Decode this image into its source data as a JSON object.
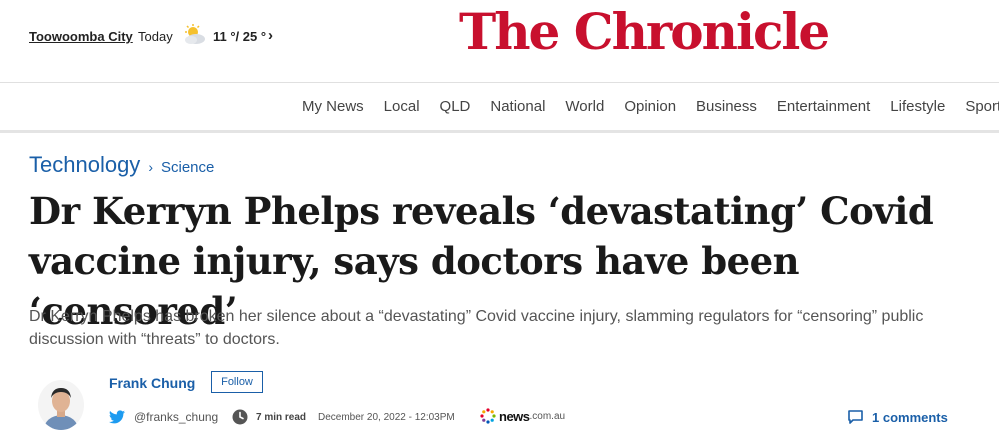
{
  "header": {
    "location": "Toowoomba City",
    "today_label": "Today",
    "weather_icon": "partly-cloudy-icon",
    "temperature": "11 °/ 25 °",
    "brand": "The Chronicle",
    "brand_color": "#c8102e"
  },
  "nav": {
    "items": [
      "My News",
      "Local",
      "QLD",
      "National",
      "World",
      "Opinion",
      "Business",
      "Entertainment",
      "Lifestyle",
      "Sport"
    ]
  },
  "breadcrumb": {
    "section": "Technology",
    "subsection": "Science"
  },
  "article": {
    "headline": "Dr Kerryn Phelps reveals ‘devastating’ Covid vaccine injury, says doctors have been ‘censored’",
    "standfirst": "Dr Kerryn Phelps has broken her silence about a “devastating” Covid vaccine injury, slamming regulators for “censoring” public discussion with “threats” to doctors."
  },
  "byline": {
    "author": "Frank Chung",
    "follow_label": "Follow",
    "twitter_handle": "@franks_chung",
    "read_time": "7 min read",
    "date": "December 20, 2022 - 12:03PM",
    "source_name": "news",
    "source_tld": ".com.au",
    "comments_label": "1 comments",
    "link_color": "#1a5fa8"
  }
}
